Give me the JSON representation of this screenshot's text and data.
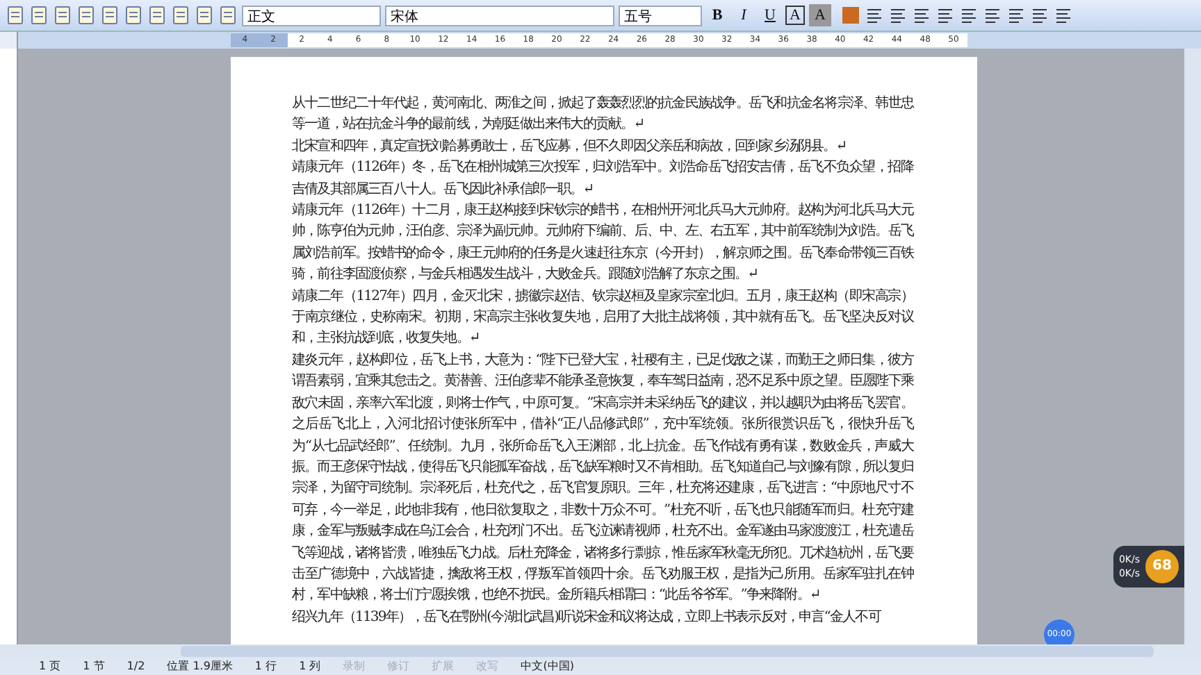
{
  "toolbar": {
    "style": "正文",
    "font": "宋体",
    "size": "五号",
    "format_buttons": [
      {
        "label": "B",
        "kind": "bold"
      },
      {
        "label": "I",
        "kind": "italic"
      },
      {
        "label": "U",
        "kind": "underline"
      },
      {
        "label": "A",
        "kind": "box"
      },
      {
        "label": "A",
        "kind": "shade"
      }
    ]
  },
  "ruler": {
    "labels": [
      "4",
      "2",
      "2",
      "4",
      "6",
      "8",
      "10",
      "12",
      "14",
      "16",
      "18",
      "20",
      "22",
      "24",
      "26",
      "28",
      "30",
      "32",
      "34",
      "36",
      "38",
      "40",
      "42",
      "44",
      "48",
      "50"
    ]
  },
  "document": {
    "paragraphs": [
      "从十二世纪二十年代起，黄河南北、两淮之间，掀起了轰轰烈烈的抗金民族战争。岳飞和抗金名将宗泽、韩世忠等一道，站在抗金斗争的最前线，为朝廷做出来伟大的贡献。↵",
      "北宋宣和四年，真定宣抚刘韐募勇敢士，岳飞应募，但不久即因父亲岳和病故，回到家乡汤阴县。↵",
      "靖康元年（1126年）冬，岳飞在相州城第三次投军，归刘浩军中。刘浩命岳飞招安吉倩，岳飞不负众望，招降吉倩及其部属三百八十人。岳飞因此补承信郎一职。↵",
      "靖康元年（1126年）十二月，康王赵构接到宋钦宗的蜡书，在相州开河北兵马大元帅府。赵构为河北兵马大元帅，陈亨伯为元帅，汪伯彦、宗泽为副元帅。元帅府下编前、后、中、左、右五军，其中前军统制为刘浩。岳飞属刘浩前军。按蜡书的命令，康王元帅府的任务是火速赶往东京（今开封），解京师之围。岳飞奉命带领三百铁骑，前往李固渡侦察，与金兵相遇发生战斗，大败金兵。跟随刘浩解了东京之围。↵",
      "靖康二年（1127年）四月，金灭北宋，掳徽宗赵佶、钦宗赵桓及皇家宗室北归。五月，康王赵构（即宋高宗）于南京继位，史称南宋。初期，宋高宗主张收复失地，启用了大批主战将领，其中就有岳飞。岳飞坚决反对议和，主张抗战到底，收复失地。↵",
      "建炎元年，赵构即位，岳飞上书，大意为：“陛下已登大宝，社稷有主，已足伐敌之谋，而勤王之师日集，彼方谓吾素弱，宜乘其怠击之。黄潜善、汪伯彦辈不能承圣意恢复，奉车驾日益南，恐不足系中原之望。臣愿陛下乘敌穴未固，亲率六军北渡，则将士作气，中原可复。”宋高宗并未采纳岳飞的建议，并以越职为由将岳飞罢官。之后岳飞北上，入河北招讨使张所军中，借补“正八品修武郎”，充中军统领。张所很赏识岳飞，很快升岳飞为“从七品武经郎”、任统制。九月，张所命岳飞入王渊部，北上抗金。岳飞作战有勇有谋，数败金兵，声威大振。而王彦保守怯战，使得岳飞只能孤军奋战，岳飞缺军粮时又不肯相助。岳飞知道自己与刘豫有隙，所以复归宗泽，为留守司统制。宗泽死后，杜充代之，岳飞官复原职。三年，杜充将还建康，岳飞进言：“中原地尺寸不可弃，今一举足，此地非我有，他日欲复取之，非数十万众不可。”杜充不听，岳飞也只能随军而归。杜充守建康，金军与叛贼李成在乌江会合，杜充闭门不出。岳飞泣谏请视师，杜充不出。金军遂由马家渡渡江，杜充遣岳飞等迎战，诸将皆溃，唯独岳飞力战。后杜充降金，诸将多行剽掠，惟岳家军秋毫无所犯。兀术趋杭州，岳飞要击至广德境中，六战皆捷，擒敌将王权，俘叛军首领四十余。岳飞劝服王权，是指为己所用。岳家军驻扎在钟村，军中缺粮，将士们宁愿挨饿，也绝不扰民。金所籍兵相谓曰：“此岳爷爷军。”争来降附。↵",
      "绍兴九年（1139年），岳飞在鄂州(今湖北武昌)听说宋金和议将达成，立即上书表示反对，申言“金人不可"
    ]
  },
  "overlay": {
    "speeds": [
      "0K/s",
      "0K/s"
    ],
    "badge": "68",
    "timer": "00:00"
  },
  "status_bar": [
    {
      "text": "1 页",
      "disabled": false
    },
    {
      "text": "1 节",
      "disabled": false
    },
    {
      "text": "1/2",
      "disabled": false
    },
    {
      "text": "位置 1.9厘米",
      "disabled": false
    },
    {
      "text": "1 行",
      "disabled": false
    },
    {
      "text": "1 列",
      "disabled": false
    },
    {
      "text": "录制",
      "disabled": true
    },
    {
      "text": "修订",
      "disabled": true
    },
    {
      "text": "扩展",
      "disabled": true
    },
    {
      "text": "改写",
      "disabled": true
    },
    {
      "text": "中文(中国)",
      "disabled": false
    }
  ]
}
